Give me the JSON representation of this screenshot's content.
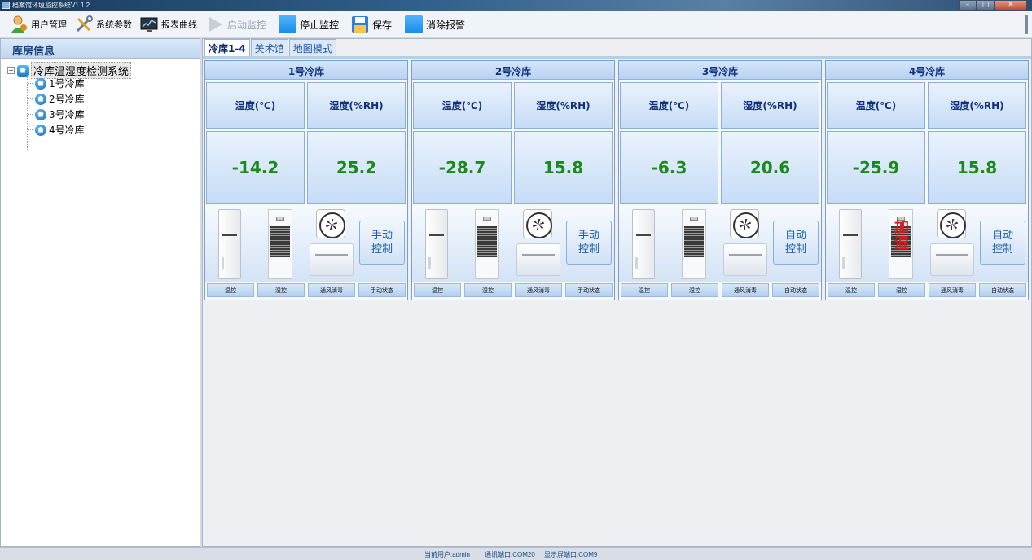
{
  "window": {
    "title": "档案馆环境监控系统V1.1.2"
  },
  "toolbar": {
    "user_mgmt": "用户管理",
    "sys_params": "系统参数",
    "report": "报表曲线",
    "start_monitor": "启动监控",
    "stop_monitor": "停止监控",
    "save": "保存",
    "clear_alarm": "消除报警"
  },
  "sidebar": {
    "header": "库房信息",
    "root": "冷库温湿度检测系统",
    "items": [
      {
        "label": "1号冷库"
      },
      {
        "label": "2号冷库"
      },
      {
        "label": "3号冷库"
      },
      {
        "label": "4号冷库"
      }
    ]
  },
  "tabs": [
    {
      "label": "冷库1-4",
      "active": true
    },
    {
      "label": "美术馆",
      "active": false
    },
    {
      "label": "地图模式",
      "active": false
    }
  ],
  "rooms": [
    {
      "name": "1号冷库",
      "temp_label": "温度(℃)",
      "humid_label": "湿度(%RH)",
      "temp": "-14.2",
      "humid": "25.2",
      "control": "手动\n控制",
      "alarm": "",
      "status": [
        "温控",
        "湿控",
        "通风消毒",
        "手动状态"
      ]
    },
    {
      "name": "2号冷库",
      "temp_label": "温度(℃)",
      "humid_label": "湿度(%RH)",
      "temp": "-28.7",
      "humid": "15.8",
      "control": "手动\n控制",
      "alarm": "",
      "status": [
        "温控",
        "湿控",
        "通风消毒",
        "手动状态"
      ]
    },
    {
      "name": "3号冷库",
      "temp_label": "温度(℃)",
      "humid_label": "湿度(%RH)",
      "temp": "-6.3",
      "humid": "20.6",
      "control": "自动\n控制",
      "alarm": "",
      "status": [
        "温控",
        "湿控",
        "通风消毒",
        "自动状态"
      ]
    },
    {
      "name": "4号冷库",
      "temp_label": "温度(℃)",
      "humid_label": "湿度(%RH)",
      "temp": "-25.9",
      "humid": "15.8",
      "control": "自动\n控制",
      "alarm": "加\n湿",
      "status": [
        "温控",
        "湿控",
        "通风消毒",
        "自动状态"
      ]
    }
  ],
  "statusbar": {
    "user": "当前用户:admin",
    "comm_port": "通讯端口:COM20",
    "display_port": "显示屏端口:COM9"
  }
}
